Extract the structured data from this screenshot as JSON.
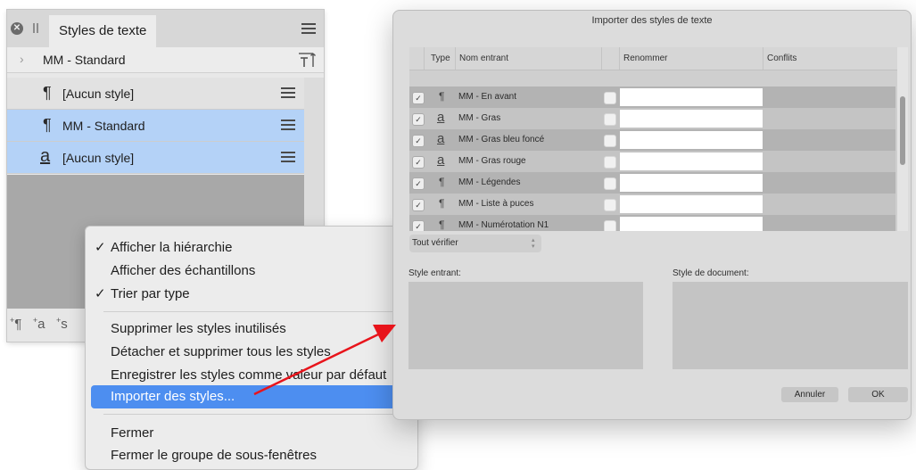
{
  "panel": {
    "tab_label": "Styles de texte",
    "breadcrumb": "MM - Standard",
    "rows": [
      {
        "glyph": "¶",
        "name": "[Aucun style]",
        "state": "neutral"
      },
      {
        "glyph": "¶",
        "name": "MM - Standard",
        "state": "selected"
      },
      {
        "glyph": "a",
        "name": "[Aucun style]",
        "state": "selected"
      }
    ],
    "footer_icons": {
      "para": "¶",
      "char": "a",
      "group": "s"
    }
  },
  "context_menu": {
    "items": [
      {
        "label": "Afficher la hiérarchie",
        "checked": true
      },
      {
        "label": "Afficher des échantillons",
        "checked": false
      },
      {
        "label": "Trier par type",
        "checked": true
      },
      {
        "label": "Supprimer les styles inutilisés",
        "checked": false
      },
      {
        "label": "Détacher et supprimer tous les styles",
        "checked": false
      },
      {
        "label": "Enregistrer les styles comme valeur par défaut",
        "checked": false
      },
      {
        "label": "Importer des styles...",
        "checked": false,
        "highlighted": true
      },
      {
        "label": "Fermer",
        "checked": false
      },
      {
        "label": "Fermer le groupe de sous-fenêtres",
        "checked": false
      }
    ],
    "check_glyph": "✓"
  },
  "dialog": {
    "title": "Importer des styles de texte",
    "columns": {
      "type": "Type",
      "incoming": "Nom entrant",
      "rename": "Renommer",
      "conflicts": "Conflits"
    },
    "rows": [
      {
        "glyph": "¶",
        "name": "MM - En avant"
      },
      {
        "glyph": "a",
        "name": "MM - Gras"
      },
      {
        "glyph": "a",
        "name": "MM - Gras bleu foncé"
      },
      {
        "glyph": "a",
        "name": "MM - Gras rouge"
      },
      {
        "glyph": "¶",
        "name": "MM - Légendes"
      },
      {
        "glyph": "¶",
        "name": "MM - Liste à puces"
      },
      {
        "glyph": "¶",
        "name": "MM - Numérotation N1"
      }
    ],
    "select_all": "Tout vérifier",
    "incoming_style_label": "Style entrant:",
    "document_style_label": "Style de document:",
    "cancel": "Annuler",
    "ok": "OK"
  },
  "colors": {
    "selection": "#b4d2f7",
    "menu_highlight": "#4d8ef0",
    "arrow": "#e8141b"
  }
}
